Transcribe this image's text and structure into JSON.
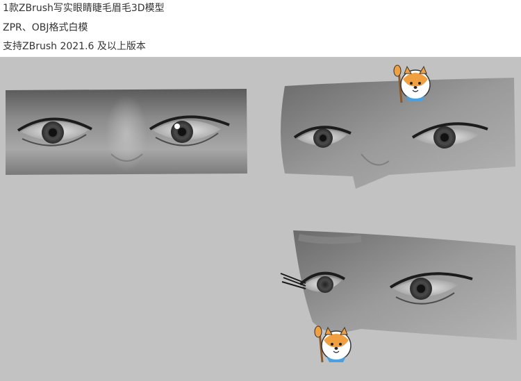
{
  "description_lines": [
    "1款ZBrush写实眼睛睫毛眉毛3D模型",
    "ZPR、OBJ格式白模",
    "支持ZBrush 2021.6 及以上版本"
  ],
  "colors": {
    "canvas_bg": "#c2c2c2",
    "text": "#333333",
    "mascot_orange": "#f0a040",
    "mascot_scarf": "#4aa0e0"
  },
  "icons": [
    "shiba-mascot-icon",
    "paintbrush-icon"
  ]
}
